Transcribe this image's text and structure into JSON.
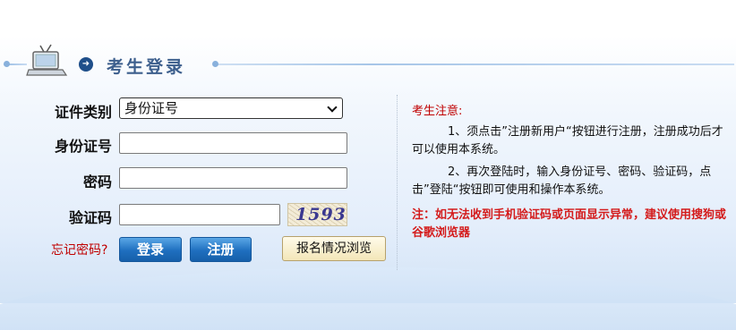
{
  "header": {
    "title": "考生登录"
  },
  "form": {
    "id_type_label": "证件类别",
    "id_type_value": "身份证号",
    "id_number_label": "身份证号",
    "password_label": "密码",
    "captcha_label": "验证码",
    "captcha_text": "1593",
    "forgot_link": "忘记密码?",
    "login_button": "登录",
    "register_button": "注册",
    "browse_button": "报名情况浏览"
  },
  "notice": {
    "title": "考生注意:",
    "item1": "1、须点击”注册新用户“按钮进行注册，注册成功后才可以使用本系统。",
    "item2": "2、再次登陆时，输入身份证号、密码、验证码，点击”登陆“按钮即可使用和操作本系统。",
    "warning": "注：如无法收到手机验证码或页面显示异常，建议使用搜狗或谷歌浏览器"
  },
  "colors": {
    "title": "#3d5f8d",
    "button_blue": "#1f6fbf",
    "notice_red": "#c00000"
  },
  "icons": [
    "laptop-icon",
    "arrow-right-icon",
    "chevron-down-icon"
  ]
}
